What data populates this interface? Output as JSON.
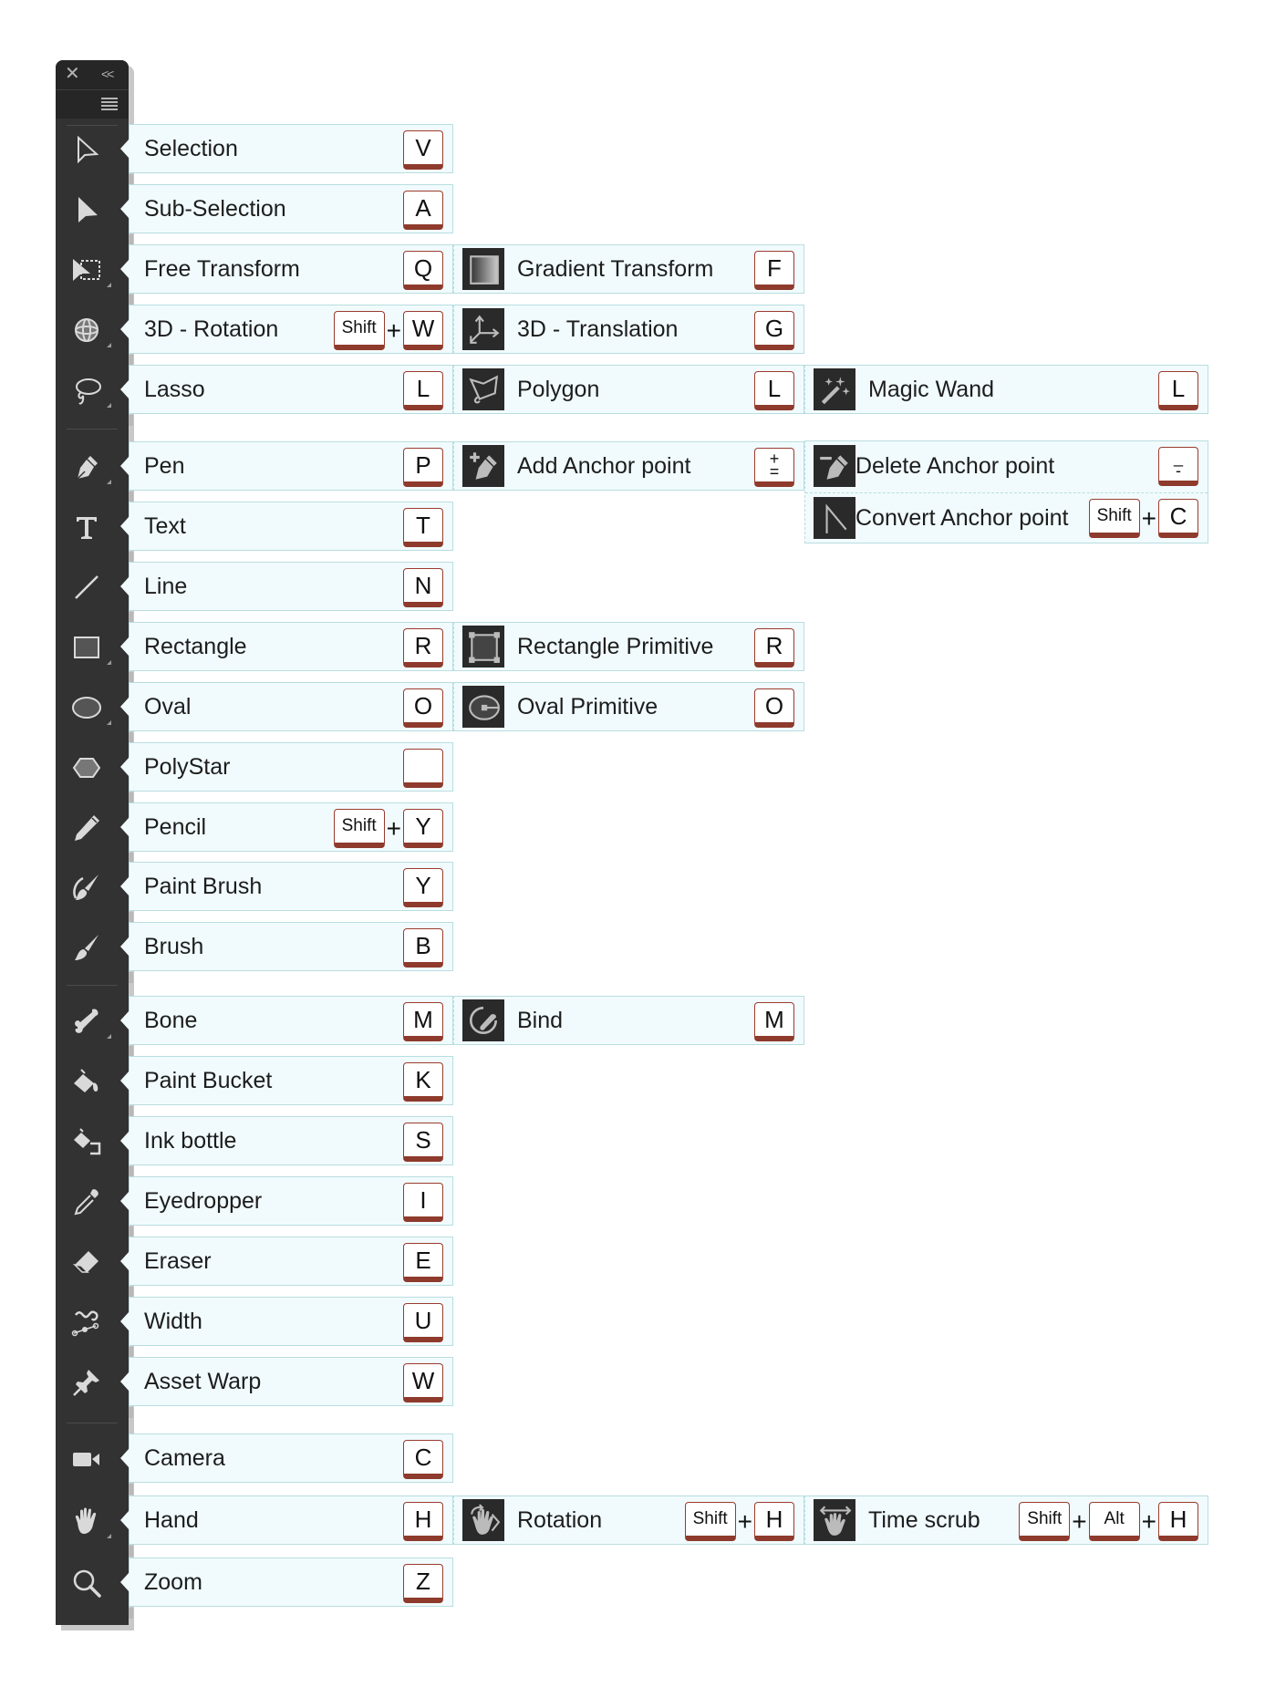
{
  "panel": {
    "close_icon": "close-icon",
    "collapse_label": "<<",
    "menu_icon": "hamburger-menu-icon"
  },
  "colors": {
    "panel_bg": "#323232",
    "row_bg": "#f1fbfd",
    "row_border": "#b9dde0",
    "key_border": "#8e3a2c",
    "icon_fill": "#d9d9d9"
  },
  "tools": [
    {
      "name": "Selection",
      "icon": "selection-arrow-icon",
      "keys": [
        "V"
      ]
    },
    {
      "name": "Sub-Selection",
      "icon": "subselection-arrow-icon",
      "keys": [
        "A"
      ]
    },
    {
      "name": "Free Transform",
      "icon": "free-transform-icon",
      "keys": [
        "Q"
      ],
      "sub": [
        {
          "name": "Gradient Transform",
          "icon": "gradient-transform-icon",
          "keys": [
            "F"
          ]
        }
      ]
    },
    {
      "name": "3D - Rotation",
      "icon": "3d-rotation-icon",
      "keys": [
        "Shift",
        "W"
      ],
      "sub": [
        {
          "name": "3D - Translation",
          "icon": "3d-translation-icon",
          "keys": [
            "G"
          ]
        }
      ]
    },
    {
      "name": "Lasso",
      "icon": "lasso-icon",
      "keys": [
        "L"
      ],
      "sub": [
        {
          "name": "Polygon",
          "icon": "polygon-lasso-icon",
          "keys": [
            "L"
          ]
        },
        {
          "name": "Magic Wand",
          "icon": "magic-wand-icon",
          "keys": [
            "L"
          ]
        }
      ]
    },
    {
      "name": "Pen",
      "icon": "pen-icon",
      "keys": [
        "P"
      ],
      "sub": [
        {
          "name": "Add Anchor point",
          "icon": "add-anchor-icon",
          "keys": [
            "+\n="
          ]
        },
        {
          "name": "Delete Anchor point",
          "icon": "delete-anchor-icon",
          "keys": [
            "_\n-"
          ]
        },
        {
          "name": "Convert Anchor point",
          "icon": "convert-anchor-icon",
          "keys": [
            "Shift",
            "C"
          ]
        }
      ]
    },
    {
      "name": "Text",
      "icon": "text-icon",
      "keys": [
        "T"
      ]
    },
    {
      "name": "Line",
      "icon": "line-icon",
      "keys": [
        "N"
      ]
    },
    {
      "name": "Rectangle",
      "icon": "rectangle-icon",
      "keys": [
        "R"
      ],
      "sub": [
        {
          "name": "Rectangle Primitive",
          "icon": "rectangle-primitive-icon",
          "keys": [
            "R"
          ]
        }
      ]
    },
    {
      "name": "Oval",
      "icon": "oval-icon",
      "keys": [
        "O"
      ],
      "sub": [
        {
          "name": "Oval Primitive",
          "icon": "oval-primitive-icon",
          "keys": [
            "O"
          ]
        }
      ]
    },
    {
      "name": "PolyStar",
      "icon": "polystar-icon",
      "keys": [
        ""
      ]
    },
    {
      "name": "Pencil",
      "icon": "pencil-icon",
      "keys": [
        "Shift",
        "Y"
      ]
    },
    {
      "name": "Paint Brush",
      "icon": "paint-brush-icon",
      "keys": [
        "Y"
      ]
    },
    {
      "name": "Brush",
      "icon": "brush-icon",
      "keys": [
        "B"
      ]
    },
    {
      "name": "Bone",
      "icon": "bone-icon",
      "keys": [
        "M"
      ],
      "sub": [
        {
          "name": "Bind",
          "icon": "bind-icon",
          "keys": [
            "M"
          ]
        }
      ]
    },
    {
      "name": "Paint Bucket",
      "icon": "paint-bucket-icon",
      "keys": [
        "K"
      ]
    },
    {
      "name": "Ink bottle",
      "icon": "ink-bottle-icon",
      "keys": [
        "S"
      ]
    },
    {
      "name": "Eyedropper",
      "icon": "eyedropper-icon",
      "keys": [
        "I"
      ]
    },
    {
      "name": "Eraser",
      "icon": "eraser-icon",
      "keys": [
        "E"
      ]
    },
    {
      "name": "Width",
      "icon": "width-tool-icon",
      "keys": [
        "U"
      ]
    },
    {
      "name": "Asset Warp",
      "icon": "asset-warp-pin-icon",
      "keys": [
        "W"
      ]
    },
    {
      "name": "Camera",
      "icon": "camera-icon",
      "keys": [
        "C"
      ]
    },
    {
      "name": "Hand",
      "icon": "hand-icon",
      "keys": [
        "H"
      ],
      "sub": [
        {
          "name": "Rotation",
          "icon": "rotation-hand-icon",
          "keys": [
            "Shift",
            "H"
          ]
        },
        {
          "name": "Time scrub",
          "icon": "time-scrub-icon",
          "keys": [
            "Shift",
            "Alt",
            "H"
          ]
        }
      ]
    },
    {
      "name": "Zoom",
      "icon": "zoom-magnifier-icon",
      "keys": [
        "Z"
      ]
    }
  ],
  "plus_label": "+"
}
